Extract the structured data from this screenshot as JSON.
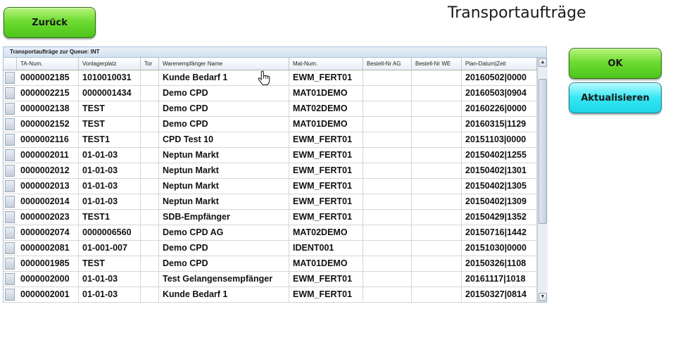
{
  "header": {
    "back_label": "Zurück",
    "title": "Transportaufträge"
  },
  "actions": {
    "ok_label": "OK",
    "refresh_label": "Aktualisieren"
  },
  "grid": {
    "caption": "Transportaufträge zur Queue: INT",
    "columns": [
      "TA-Num.",
      "Vonlagerplatz",
      "Tor",
      "Warenempfänger Name",
      "Mat-Num.",
      "Bestell-Nr AG",
      "Bestell-Nr WE",
      "Plan-Datum|Zeit"
    ],
    "rows": [
      [
        "0000002185",
        "1010010031",
        "",
        "Kunde Bedarf 1",
        "EWM_FERT01",
        "",
        "",
        "20160502|0000"
      ],
      [
        "0000002215",
        "0000001434",
        "",
        "Demo CPD",
        "MAT01DEMO",
        "",
        "",
        "20160503|0904"
      ],
      [
        "0000002138",
        "TEST",
        "",
        "Demo CPD",
        "MAT02DEMO",
        "",
        "",
        "20160226|0000"
      ],
      [
        "0000002152",
        "TEST",
        "",
        "Demo CPD",
        "MAT01DEMO",
        "",
        "",
        "20160315|1129"
      ],
      [
        "0000002116",
        "TEST1",
        "",
        "CPD Test 10",
        "EWM_FERT01",
        "",
        "",
        "20151103|0000"
      ],
      [
        "0000002011",
        "01-01-03",
        "",
        "Neptun Markt",
        "EWM_FERT01",
        "",
        "",
        "20150402|1255"
      ],
      [
        "0000002012",
        "01-01-03",
        "",
        "Neptun Markt",
        "EWM_FERT01",
        "",
        "",
        "20150402|1301"
      ],
      [
        "0000002013",
        "01-01-03",
        "",
        "Neptun Markt",
        "EWM_FERT01",
        "",
        "",
        "20150402|1305"
      ],
      [
        "0000002014",
        "01-01-03",
        "",
        "Neptun Markt",
        "EWM_FERT01",
        "",
        "",
        "20150402|1309"
      ],
      [
        "0000002023",
        "TEST1",
        "",
        "SDB-Empfänger",
        "EWM_FERT01",
        "",
        "",
        "20150429|1352"
      ],
      [
        "0000002074",
        "0000006560",
        "",
        "Demo CPD AG",
        "MAT02DEMO",
        "",
        "",
        "20150716|1442"
      ],
      [
        "0000002081",
        "01-001-007",
        "",
        "Demo CPD",
        "IDENT001",
        "",
        "",
        "20151030|0000"
      ],
      [
        "0000001985",
        "TEST",
        "",
        "Demo CPD",
        "MAT01DEMO",
        "",
        "",
        "20150326|1108"
      ],
      [
        "0000002000",
        "01-01-03",
        "",
        "Test Gelangensempfänger",
        "EWM_FERT01",
        "",
        "",
        "20161117|1018"
      ],
      [
        "0000002001",
        "01-01-03",
        "",
        "Kunde Bedarf 1",
        "EWM_FERT01",
        "",
        "",
        "20150327|0814"
      ]
    ]
  },
  "icons": {
    "scroll_up": "scroll-up-arrow-icon",
    "scroll_down": "scroll-down-arrow-icon",
    "cursor": "hand-pointer-icon"
  }
}
